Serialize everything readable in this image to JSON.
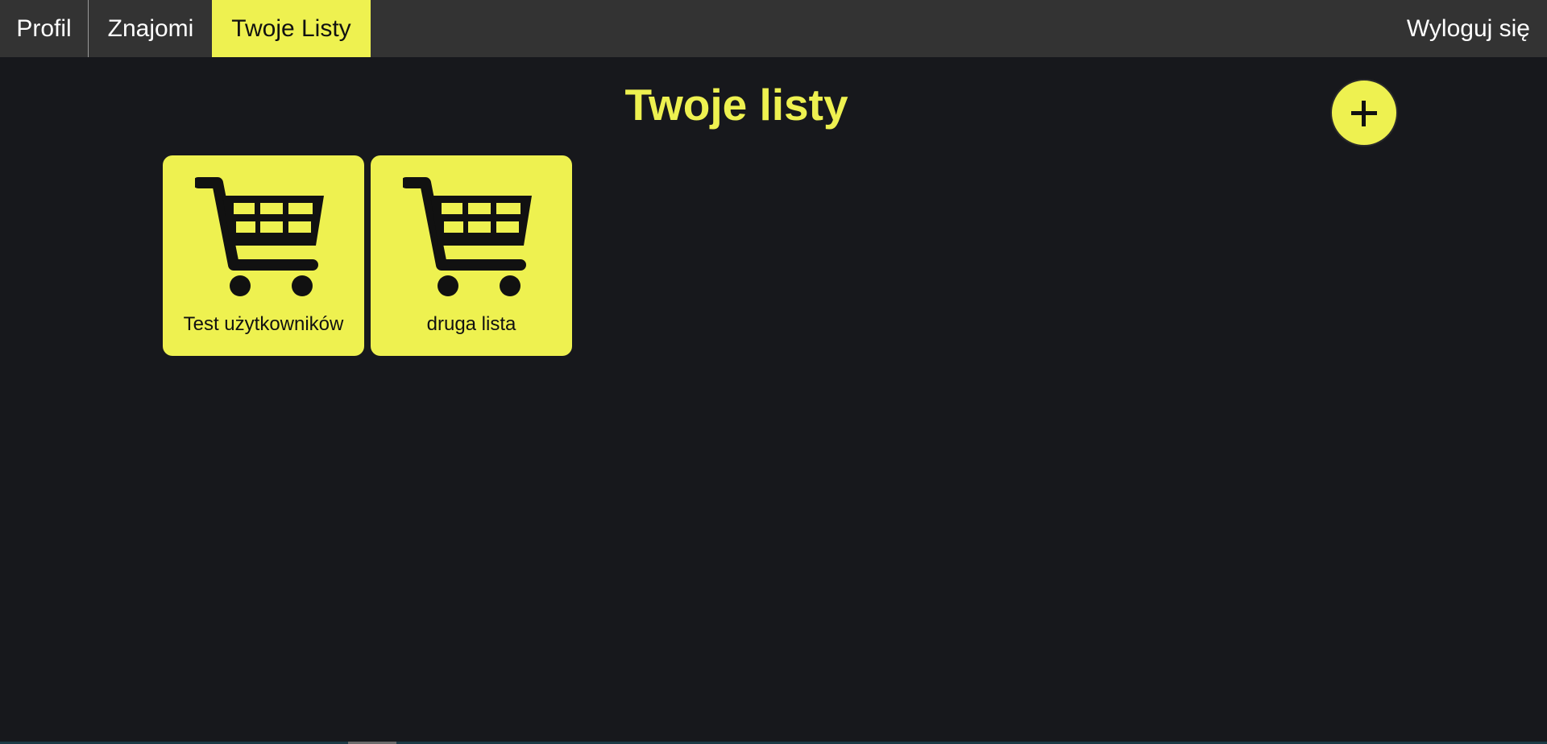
{
  "nav": {
    "items": [
      {
        "label": "Profil"
      },
      {
        "label": "Znajomi"
      },
      {
        "label": "Twoje Listy",
        "active": true
      }
    ],
    "logout_label": "Wyloguj się"
  },
  "main": {
    "title": "Twoje listy",
    "add_button_icon": "plus-icon",
    "lists": [
      {
        "name": "Test użytkowników",
        "icon": "shopping-cart-icon"
      },
      {
        "name": "druga lista",
        "icon": "shopping-cart-icon"
      }
    ]
  },
  "colors": {
    "background": "#17181c",
    "navbar": "#333333",
    "accent": "#eef150",
    "text_dark": "#111111",
    "text_light": "#ffffff"
  }
}
